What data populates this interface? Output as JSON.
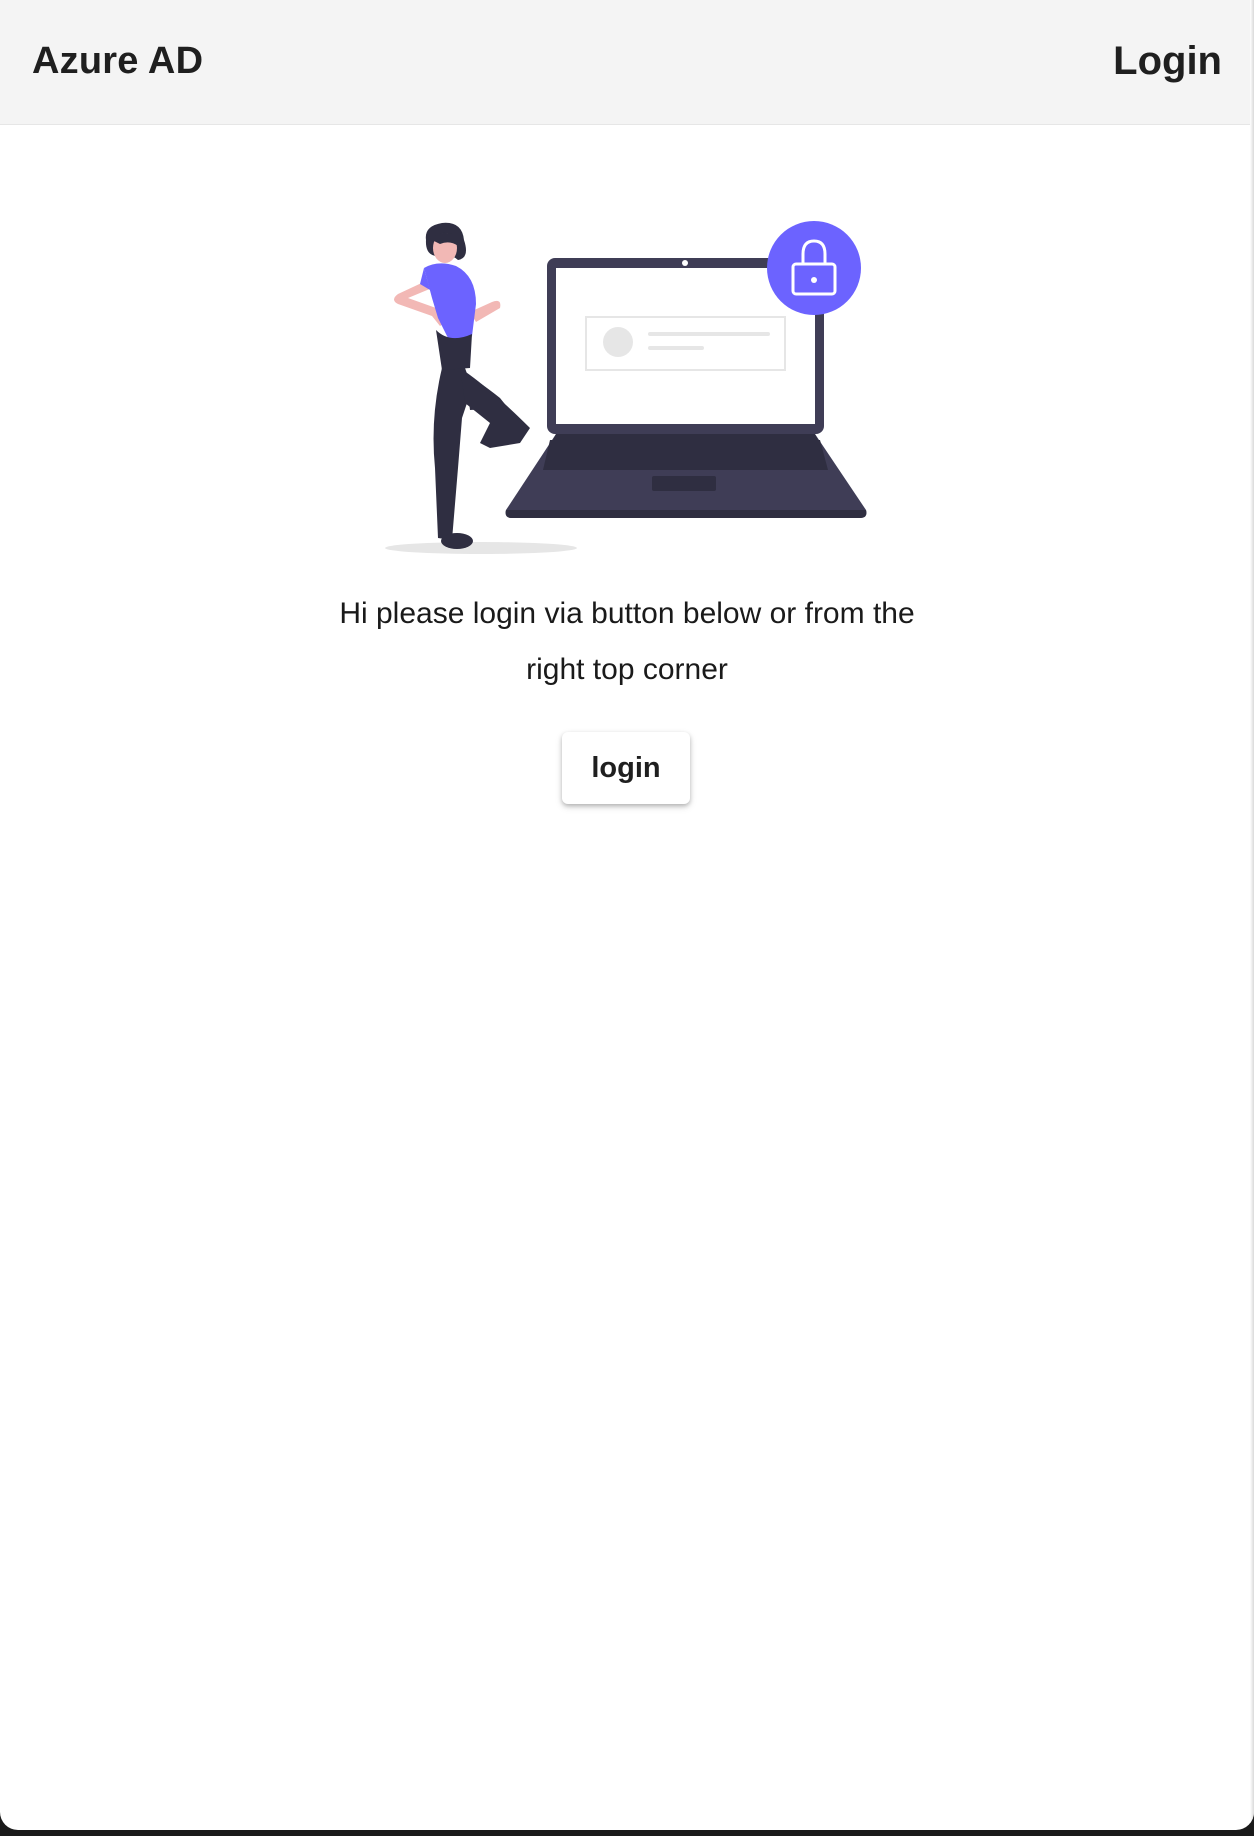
{
  "header": {
    "title": "Azure AD",
    "login_label": "Login"
  },
  "main": {
    "message_line1": "Hi please login via button below or from the",
    "message_line2": "right top corner",
    "login_button_label": "login"
  },
  "colors": {
    "header_bg": "#f4f4f4",
    "accent": "#6c63ff",
    "laptop_dark": "#3f3d56",
    "text": "#1a1a1a"
  },
  "icons": [
    "lock-icon"
  ]
}
